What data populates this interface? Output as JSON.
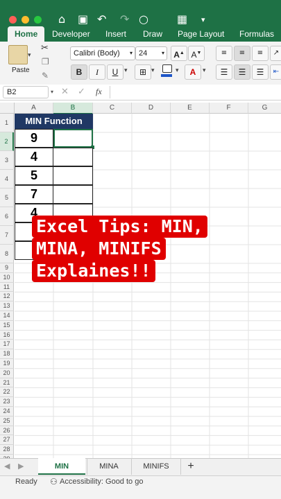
{
  "app": {
    "title": "Excel",
    "colors": {
      "brand": "#1e7145",
      "banner": "#e00000",
      "header": "#203864"
    }
  },
  "ribbon": {
    "tabs": [
      "Home",
      "Developer",
      "Insert",
      "Draw",
      "Page Layout",
      "Formulas"
    ],
    "active_tab": "Home",
    "paste_label": "Paste",
    "font_name": "Calibri (Body)",
    "font_size": "24",
    "bold": "B",
    "italic": "I",
    "underline": "U"
  },
  "formula_bar": {
    "name_box": "B2",
    "fx": "fx",
    "value": ""
  },
  "grid": {
    "columns": [
      "A",
      "B",
      "C",
      "D",
      "E",
      "F",
      "G"
    ],
    "selected_column": "B",
    "rows": [
      "1",
      "2",
      "3",
      "4",
      "5",
      "6",
      "7",
      "8",
      "9",
      "10",
      "11",
      "12",
      "13",
      "14",
      "15",
      "16",
      "17",
      "18",
      "19",
      "20",
      "21",
      "22",
      "23",
      "24",
      "25",
      "26",
      "27",
      "28",
      "29"
    ],
    "header_cell": "MIN Function",
    "values": [
      "9",
      "4",
      "5",
      "7",
      "4"
    ]
  },
  "overlay": {
    "lines": [
      "Excel Tips: MIN,",
      "MINA, MINIFS",
      "Explaines!!"
    ]
  },
  "sheets": {
    "tabs": [
      "MIN",
      "MINA",
      "MINIFS"
    ],
    "active": "MIN",
    "add": "+"
  },
  "status": {
    "ready": "Ready",
    "accessibility": "Accessibility: Good to go"
  }
}
